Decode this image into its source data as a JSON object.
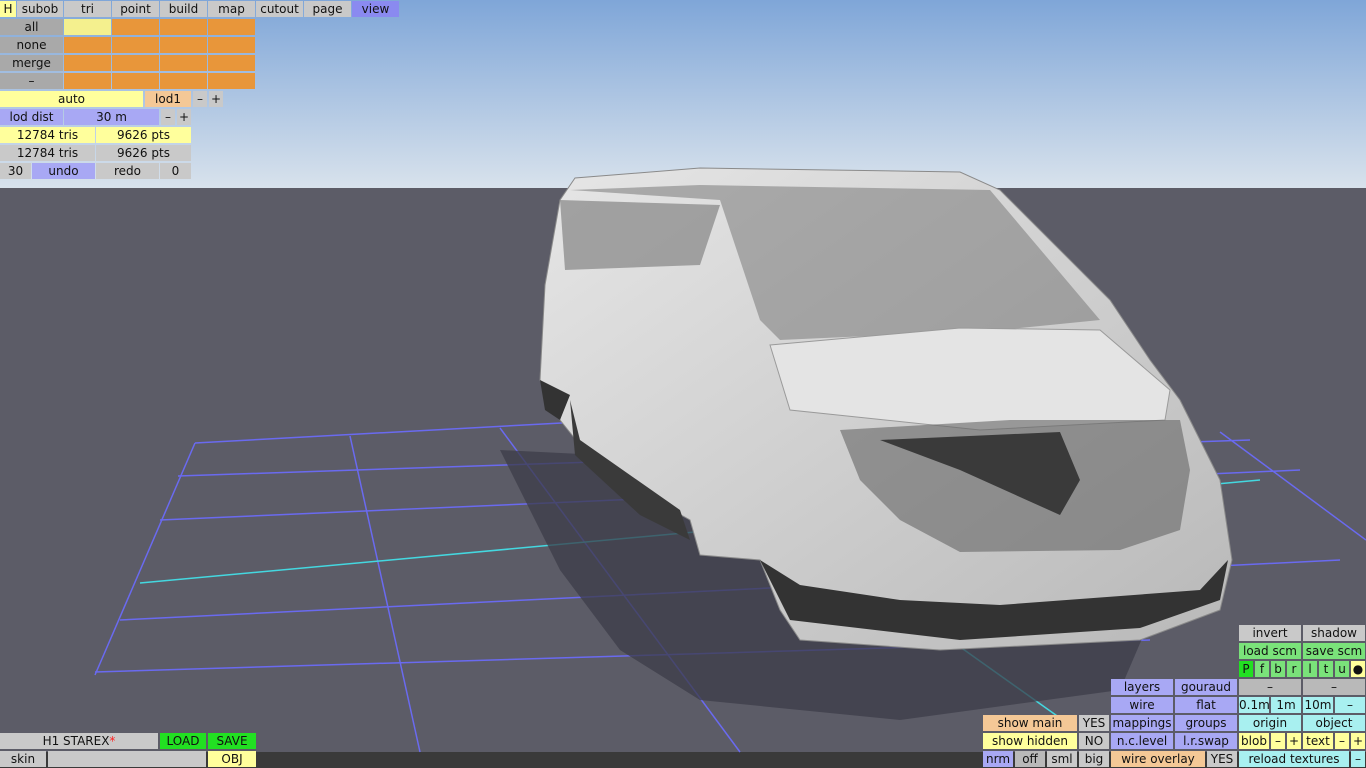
{
  "app": {
    "menu": [
      "H",
      "subob",
      "tri",
      "point",
      "build",
      "map",
      "cutout",
      "page",
      "view"
    ],
    "active_tab": "view"
  },
  "selection": {
    "all": "all",
    "none": "none",
    "merge": "merge",
    "minus": "–"
  },
  "lod": {
    "mode": "auto",
    "level": "lod1",
    "minus": "–",
    "plus": "+",
    "dist_label": "lod dist",
    "dist_value": "30 m",
    "tris1": "12784 tris",
    "pts1": "9626 pts",
    "tris2": "12784 tris",
    "pts2": "9626 pts"
  },
  "history": {
    "undo_count": "30",
    "undo": "undo",
    "redo": "redo",
    "redo_count": "0"
  },
  "file": {
    "name": "H1 STAREX",
    "modified_mark": "*",
    "load": "LOAD",
    "save": "SAVE",
    "skin": "skin",
    "obj": "OBJ"
  },
  "view_panel": {
    "invert": "invert",
    "shadow": "shadow",
    "load_scm": "load scm",
    "save_scm": "save scm",
    "views": [
      "P",
      "f",
      "b",
      "r",
      "l",
      "t",
      "u",
      "●"
    ],
    "layers": "layers",
    "gouraud": "gouraud",
    "wire": "wire",
    "flat": "flat",
    "mappings": "mappings",
    "groups": "groups",
    "nclevel": "n.c.level",
    "lrswap": "l.r.swap",
    "wire_overlay": "wire overlay",
    "wire_overlay_val": "YES",
    "show_main": "show main",
    "show_main_val": "YES",
    "show_hidden": "show hidden",
    "show_hidden_val": "NO",
    "nrm": "nrm",
    "off": "off",
    "sml": "sml",
    "big": "big",
    "dash1": "–",
    "dash2": "–",
    "grid_01": "0.1m",
    "grid_1": "1m",
    "grid_10": "10m",
    "grid_minus": "–",
    "origin": "origin",
    "object": "object",
    "blob": "blob",
    "blob_minus": "–",
    "blob_plus": "+",
    "text": "text",
    "text_minus": "–",
    "text_plus": "+",
    "reload_textures": "reload textures",
    "reload_minus": "–"
  }
}
